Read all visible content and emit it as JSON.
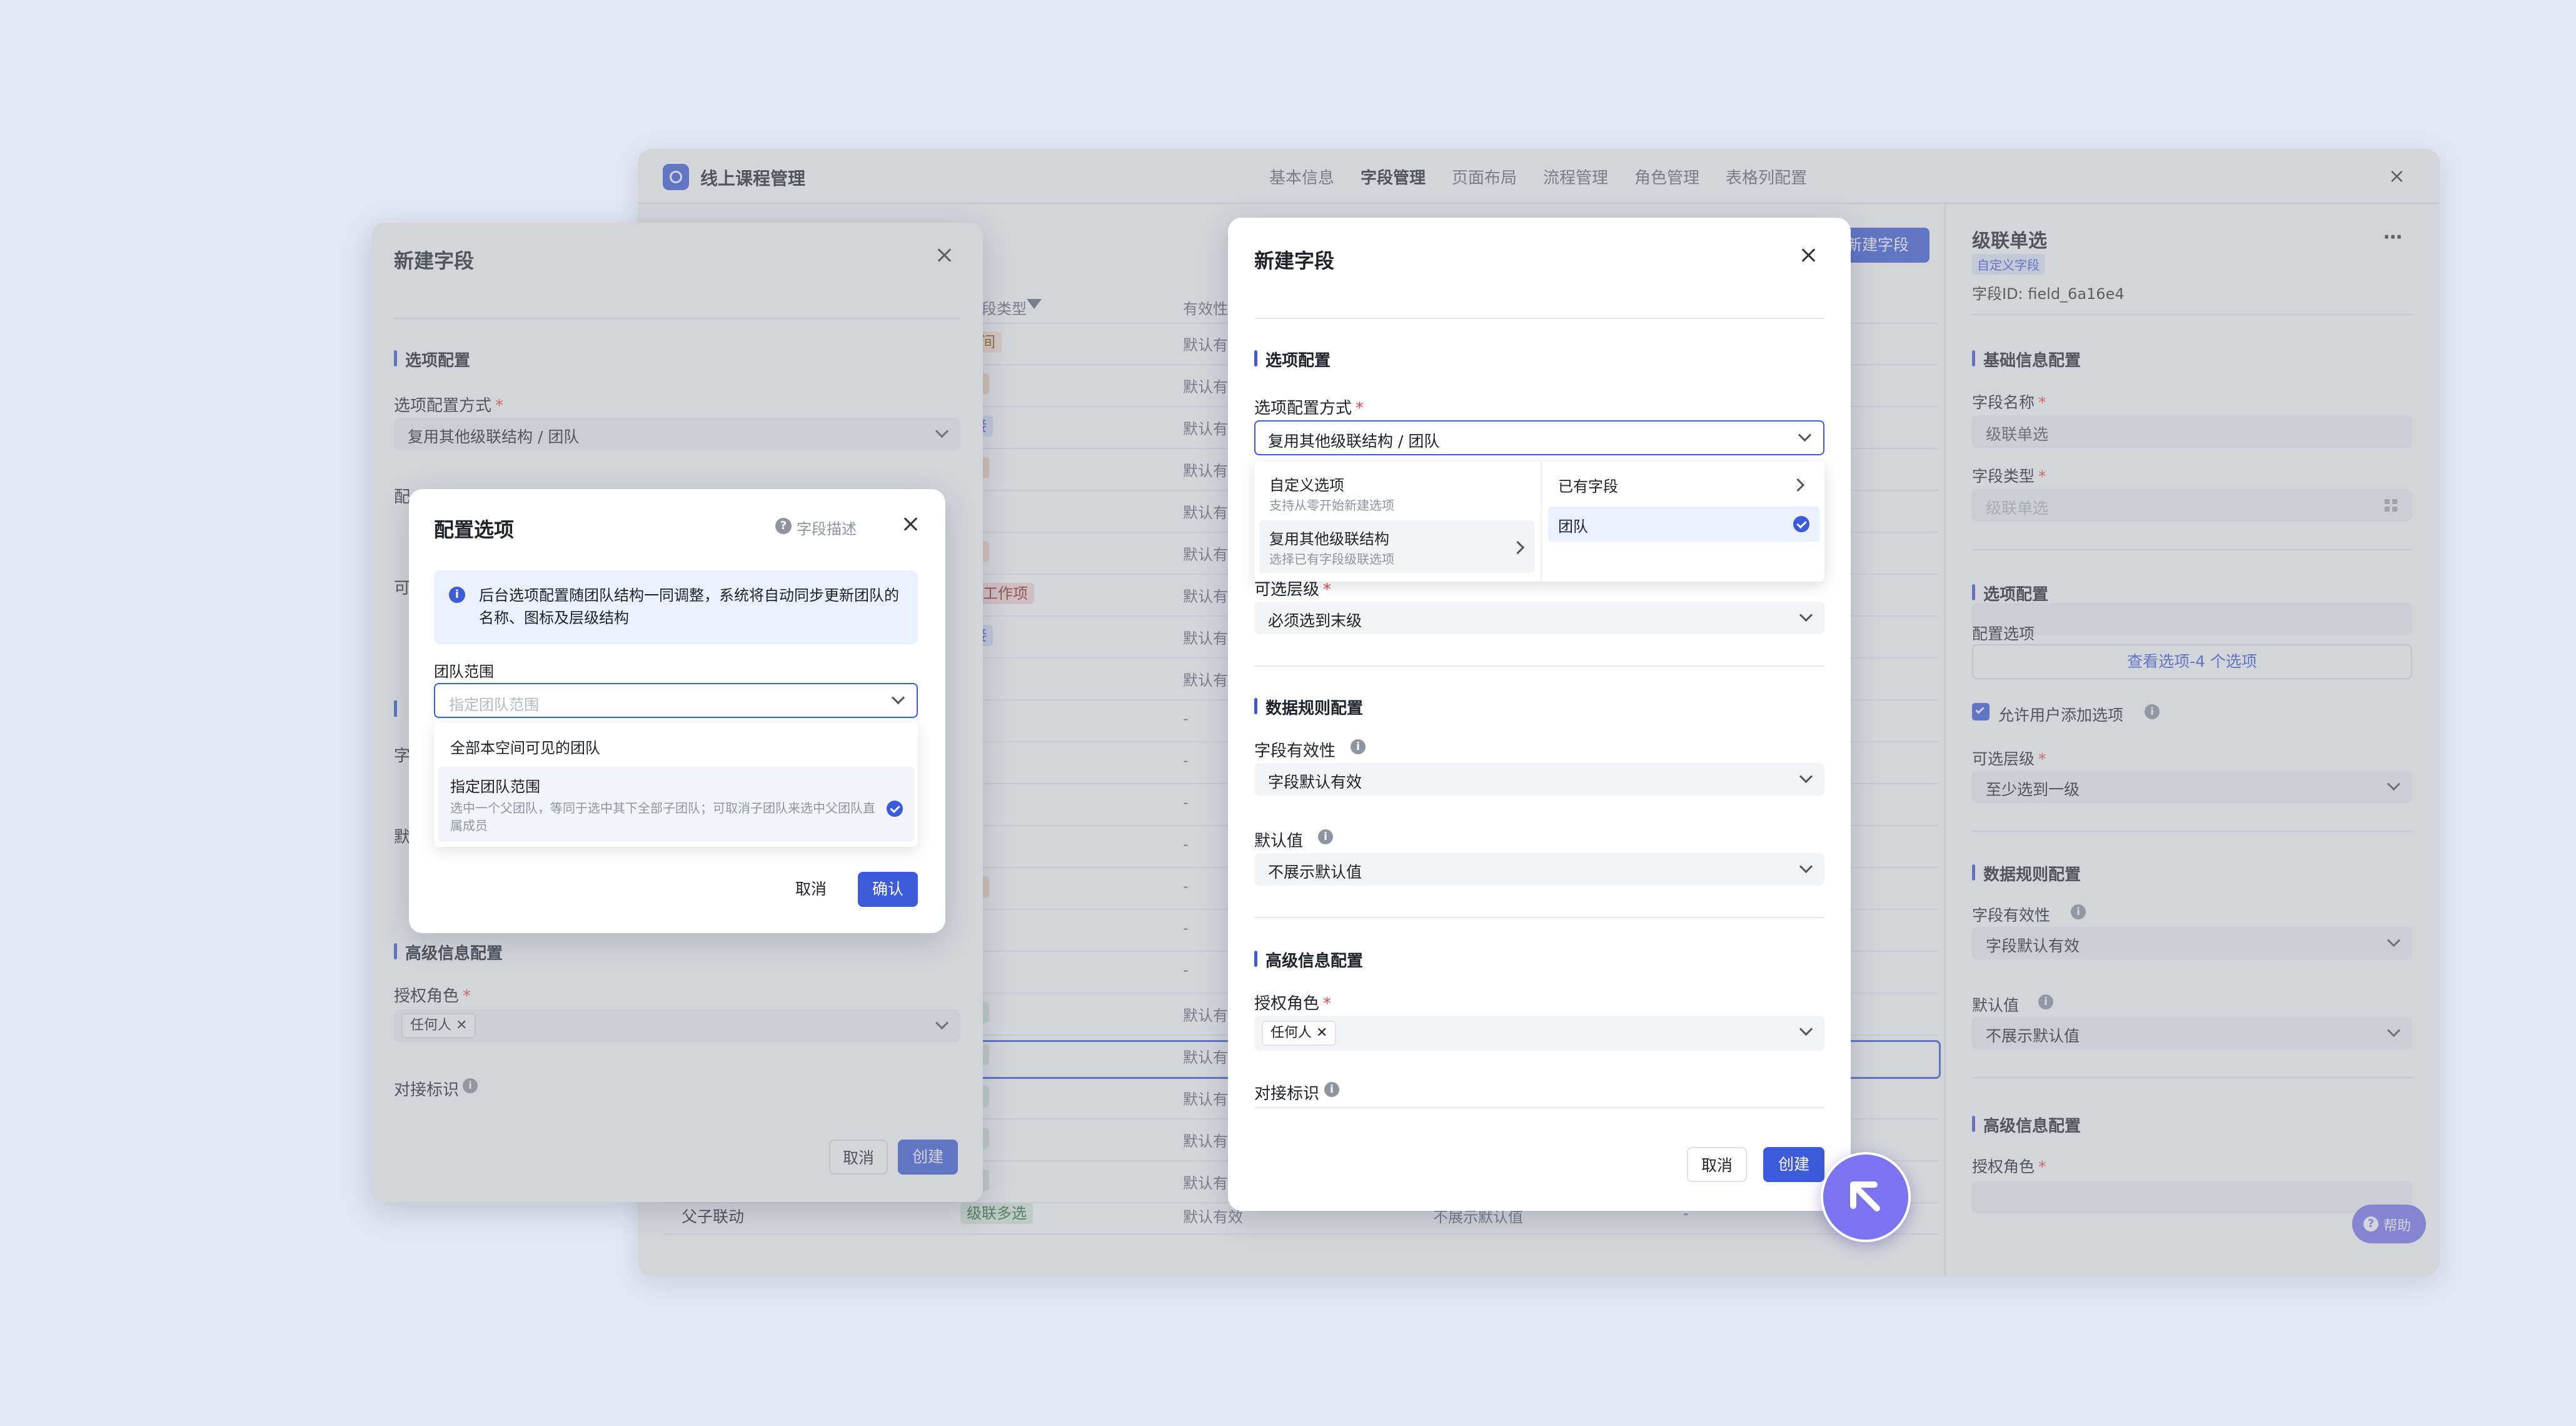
{
  "app": {
    "title": "线上课程管理",
    "tabs": [
      "基本信息",
      "字段管理",
      "页面布局",
      "流程管理",
      "角色管理",
      "表格列配置"
    ],
    "active_tab": "字段管理"
  },
  "table": {
    "header_type": "段类型",
    "header_valid": "有效性",
    "add_button": "新建字段",
    "rows": [
      {
        "type": "期+时间",
        "valid": "默认有"
      },
      {
        "type": "行文本",
        "valid": "默认有"
      },
      {
        "type": "RL链接",
        "valid": "默认有"
      },
      {
        "type": "行文本",
        "valid": "默认有"
      },
      {
        "type": "选",
        "valid": "默认有"
      },
      {
        "type": "选人员",
        "valid": "默认有"
      },
      {
        "type": "选关联工作项",
        "valid": "默认有"
      },
      {
        "type": "RL链接",
        "valid": "默认有"
      },
      {
        "type": "关",
        "valid": "默认有"
      },
      {
        "type": "选",
        "valid": "-"
      },
      {
        "type": "选",
        "valid": "-"
      },
      {
        "type": "关",
        "valid": "-"
      },
      {
        "type": "选",
        "valid": "-"
      },
      {
        "type": "行文本",
        "valid": "-"
      },
      {
        "type": "字",
        "valid": "-"
      },
      {
        "type": "关",
        "valid": "-"
      },
      {
        "type": "联单选",
        "valid": "默认有"
      },
      {
        "type": "联单选",
        "valid": "默认有"
      },
      {
        "type": "联多选",
        "valid": "默认有"
      },
      {
        "type": "联多选",
        "valid": "默认有"
      },
      {
        "type": "联多选",
        "valid": "默认有"
      }
    ],
    "last_row": {
      "name": "父子联动",
      "type": "级联多选",
      "valid": "默认有效",
      "default": "不展示默认值",
      "extra": "-"
    }
  },
  "right_panel": {
    "title": "级联单选",
    "badge": "自定义字段",
    "field_id": "字段ID:  field_6a16e4",
    "basic_section": "基础信息配置",
    "name_label": "字段名称",
    "name_value": "级联单选",
    "type_label": "字段类型",
    "type_value": "级联单选",
    "options_section": "选项配置",
    "config_label": "配置选项",
    "view_options": "查看选项-4 个选项",
    "allow_add": "允许用户添加选项",
    "level_label": "可选层级",
    "level_value": "至少选到一级",
    "rules_section": "数据规则配置",
    "validity_label": "字段有效性",
    "validity_value": "字段默认有效",
    "default_label": "默认值",
    "default_value": "不展示默认值",
    "advanced_section": "高级信息配置",
    "role_label": "授权角色",
    "help": "帮助"
  },
  "left_dialog": {
    "title": "新建字段",
    "options_section": "选项配置",
    "mode_label": "选项配置方式",
    "mode_value": "复用其他级联结构 / 团队",
    "frag1": "配",
    "frag2": "可",
    "frag3": "字",
    "frag4": "默",
    "advanced_section": "高级信息配置",
    "role_label": "授权角色",
    "role_chip": "任何人",
    "id_label": "对接标识",
    "cancel": "取消",
    "create": "创建"
  },
  "config_dialog": {
    "title": "配置选项",
    "desc_link": "字段描述",
    "notice": "后台选项配置随团队结构一同调整，系统将自动同步更新团队的名称、图标及层级结构",
    "scope_label": "团队范围",
    "scope_placeholder": "指定团队范围",
    "opt1": "全部本空间可见的团队",
    "opt2_title": "指定团队范围",
    "opt2_desc": "选中一个父团队，等同于选中其下全部子团队；可取消子团队来选中父团队直属成员",
    "cancel": "取消",
    "confirm": "确认"
  },
  "main_dialog": {
    "title": "新建字段",
    "options_section": "选项配置",
    "mode_label": "选项配置方式",
    "mode_value": "复用其他级联结构 / 团队",
    "menu1_title": "自定义选项",
    "menu1_desc": "支持从零开始新建选项",
    "menu2_title": "复用其他级联结构",
    "menu2_desc": "选择已有字段级联选项",
    "sub1": "已有字段",
    "sub2": "团队",
    "level_label": "可选层级",
    "level_value": "必须选到末级",
    "rules_section": "数据规则配置",
    "validity_label": "字段有效性",
    "validity_value": "字段默认有效",
    "default_label": "默认值",
    "default_value": "不展示默认值",
    "advanced_section": "高级信息配置",
    "role_label": "授权角色",
    "role_chip": "任何人",
    "id_label": "对接标识",
    "cancel": "取消",
    "create": "创建"
  },
  "colors": {
    "accent": "#3b5bdb",
    "fab": "#7b74f0"
  }
}
